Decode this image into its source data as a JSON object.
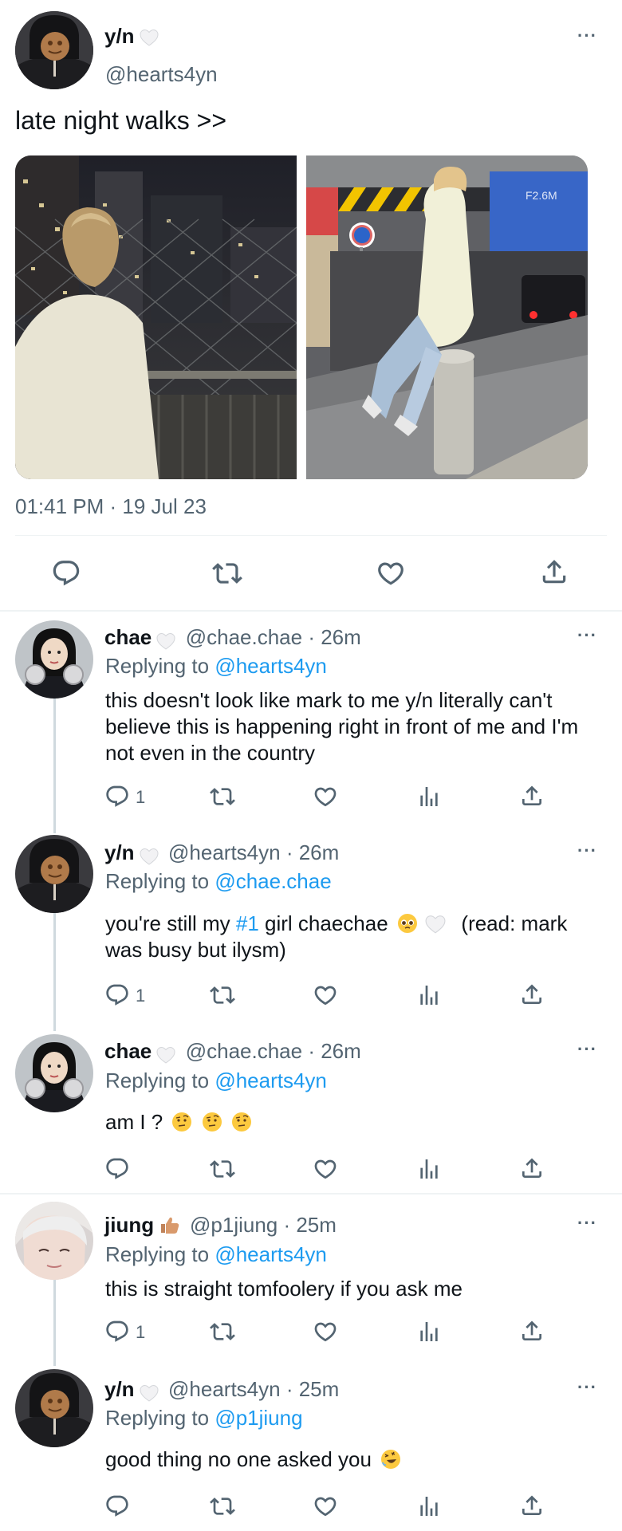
{
  "main_tweet": {
    "name": "y/n",
    "handle": "@hearts4yn",
    "text": "late night walks >>",
    "timestamp": "01:41 PM · 19 Jul 23",
    "more": "···"
  },
  "replies": [
    {
      "name": "chae",
      "handle_time": "@chae.chae · 26m",
      "replying_prefix": "Replying to ",
      "replying_to": "@hearts4yn",
      "text": "this doesn't look like mark to me y/n literally can't believe this is happening right in front of me and I'm not even in the country",
      "reply_count": "1"
    },
    {
      "name": "y/n",
      "handle_time": "@hearts4yn · 26m",
      "replying_prefix": "Replying to ",
      "replying_to": "@chae.chae",
      "text_a": "you're still my ",
      "text_hashtag": "#1",
      "text_b": " girl chaechae",
      "text_c": "(read: mark was busy but ilysm)",
      "reply_count": "1"
    },
    {
      "name": "chae",
      "handle_time": "@chae.chae · 26m",
      "replying_prefix": "Replying to ",
      "replying_to": "@hearts4yn",
      "text": "am I ?",
      "reply_count": ""
    },
    {
      "name": "jiung",
      "handle_time": "@p1jiung · 25m",
      "replying_prefix": "Replying to ",
      "replying_to": "@hearts4yn",
      "text": "this is straight tomfoolery if you ask me",
      "reply_count": "1"
    },
    {
      "name": "y/n",
      "handle_time": "@hearts4yn · 25m",
      "replying_prefix": "Replying to ",
      "replying_to": "@p1jiung",
      "text": "good thing no one asked you",
      "reply_count": ""
    }
  ],
  "more_label": "···",
  "colors": {
    "accent": "#1d9bf0",
    "secondary_text": "#536471",
    "divider": "#eff3f4",
    "thread_line": "#cfd9de"
  },
  "icons": [
    "reply-icon",
    "retweet-icon",
    "like-icon",
    "views-icon",
    "share-icon",
    "more-icon",
    "white-heart-icon",
    "thumbs-up-icon",
    "pleading-face-icon",
    "raised-eyebrow-face-icon",
    "rofl-face-icon"
  ]
}
